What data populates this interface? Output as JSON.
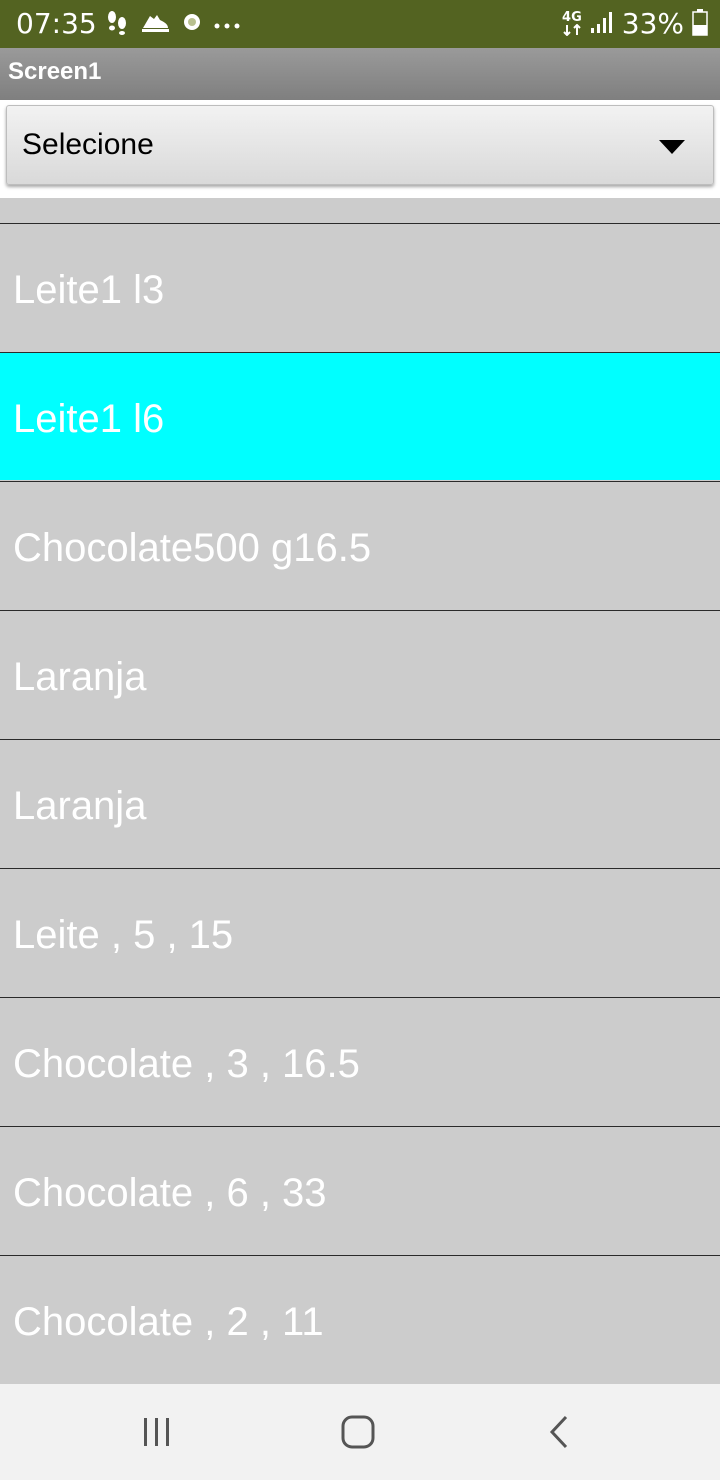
{
  "status_bar": {
    "time": "07:35",
    "network_type": "4G",
    "battery_percent": "33%",
    "bg_color": "#536321",
    "icons_left": [
      "footsteps-icon",
      "shoe-icon",
      "dot-icon",
      "more-icon"
    ],
    "icons_right": [
      "network-4g-icon",
      "signal-icon",
      "battery-icon"
    ]
  },
  "title_bar": {
    "title": "Screen1"
  },
  "spinner": {
    "selected_label": "Selecione",
    "icon": "dropdown-arrow-icon"
  },
  "list": {
    "selected_color": "#00ffff",
    "item_color": "#cccccc",
    "items": [
      {
        "label": "Leite1 l3",
        "selected": false
      },
      {
        "label": "Leite1 l6",
        "selected": true
      },
      {
        "label": "Chocolate500 g16.5",
        "selected": false
      },
      {
        "label": "Laranja",
        "selected": false
      },
      {
        "label": "Laranja",
        "selected": false
      },
      {
        "label": "Leite , 5 , 15",
        "selected": false
      },
      {
        "label": "Chocolate , 3 , 16.5",
        "selected": false
      },
      {
        "label": "Chocolate , 6 , 33",
        "selected": false
      },
      {
        "label": "Chocolate , 2 , 11",
        "selected": false
      }
    ]
  },
  "nav_bar": {
    "icons": [
      "recent-apps-icon",
      "home-icon",
      "back-icon"
    ]
  }
}
